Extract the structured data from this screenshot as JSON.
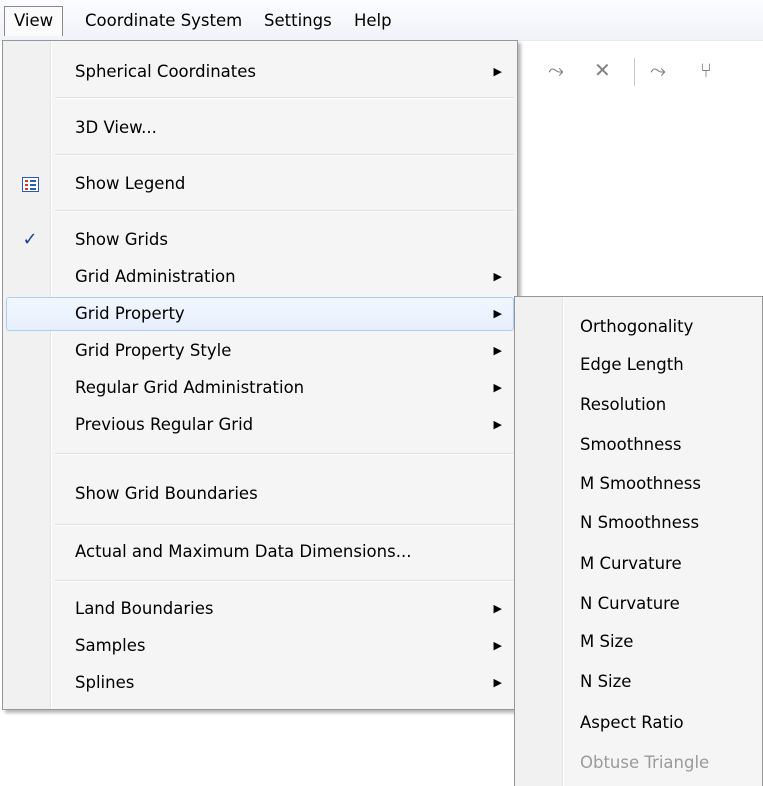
{
  "menubar": {
    "items": [
      "View",
      "Coordinate System",
      "Settings",
      "Help"
    ]
  },
  "toolbar": {
    "icons": [
      "node-icon",
      "delete-node-icon",
      "node-icon",
      "split-node-icon"
    ]
  },
  "view_menu": {
    "spherical": "Spherical Coordinates",
    "view3d": "3D View...",
    "show_legend": "Show Legend",
    "show_grids": "Show Grids",
    "grid_admin": "Grid Administration",
    "grid_property": "Grid Property",
    "grid_property_style": "Grid Property Style",
    "regular_grid_admin": "Regular Grid Administration",
    "previous_regular_grid": "Previous Regular Grid",
    "show_grid_boundaries": "Show Grid Boundaries",
    "actual_max_dims": "Actual and Maximum Data Dimensions...",
    "land_boundaries": "Land Boundaries",
    "samples": "Samples",
    "splines": "Splines",
    "checkmark": "✓",
    "arrow": "▶"
  },
  "grid_property_submenu": {
    "items": [
      "Orthogonality",
      "Edge Length",
      "Resolution",
      "Smoothness",
      "M Smoothness",
      "N Smoothness",
      "M Curvature",
      "N Curvature",
      "M Size",
      "N Size",
      "Aspect Ratio",
      "Obtuse Triangle"
    ],
    "disabled_item": "Obtuse Triangle"
  }
}
